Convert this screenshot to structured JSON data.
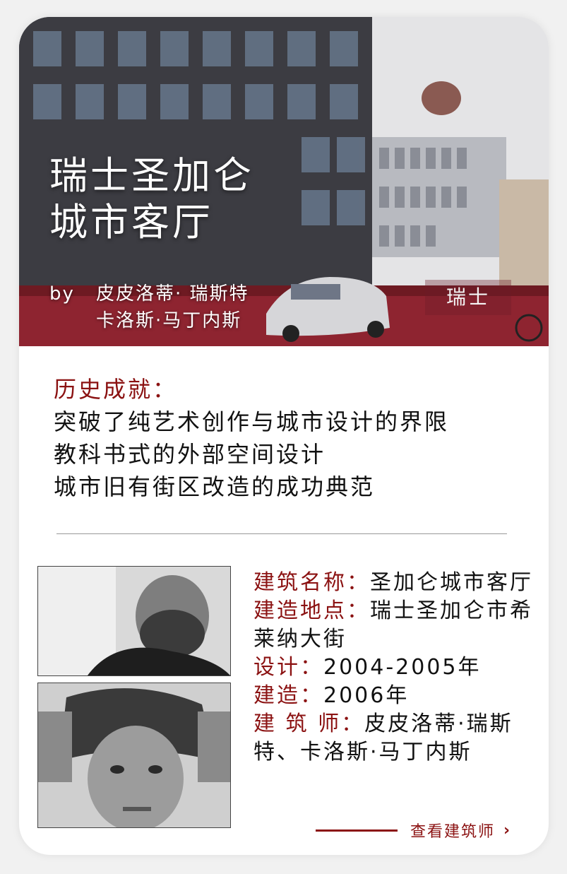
{
  "hero": {
    "title_line1": "瑞士圣加仑",
    "title_line2": "城市客厅",
    "by": "by",
    "architects_line1": "皮皮洛蒂· 瑞斯特",
    "architects_line2": "卡洛斯·马丁内斯",
    "country": "瑞士"
  },
  "achievements": {
    "title": "历史成就：",
    "items": [
      "突破了纯艺术创作与城市设计的界限",
      "教科书式的外部空间设计",
      "城市旧有街区改造的成功典范"
    ]
  },
  "details": {
    "name_label": "建筑名称：",
    "name_value": "圣加仑城市客厅",
    "location_label": "建造地点：",
    "location_value": "瑞士圣加仑市希莱纳大街",
    "design_label": "设计：",
    "design_value": "2004-2005年",
    "build_label": "建造：",
    "build_value": "2006年",
    "architect_label": "建 筑 师：",
    "architect_value": "皮皮洛蒂·瑞斯特、卡洛斯·马丁内斯"
  },
  "more_link": "查看建筑师",
  "colors": {
    "accent": "#8b1212",
    "text": "#111111",
    "card": "#ffffff"
  }
}
